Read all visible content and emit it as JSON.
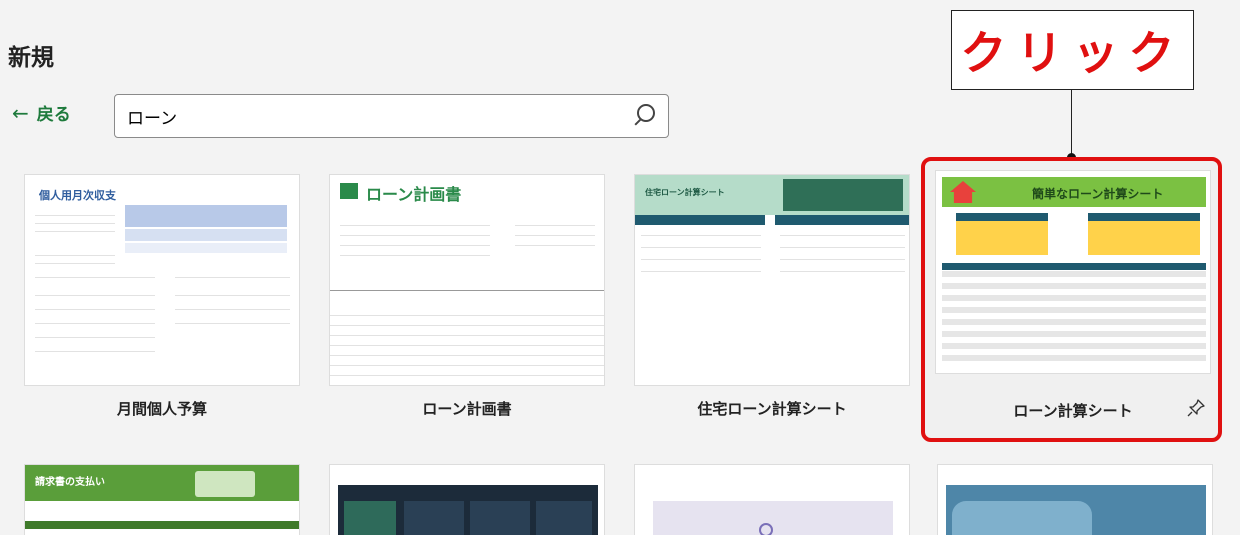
{
  "page": {
    "title": "新規"
  },
  "nav": {
    "back_label": "戻る"
  },
  "search": {
    "value": "ローン",
    "placeholder": ""
  },
  "annotation": {
    "text": "クリック",
    "color": "#e01010"
  },
  "accent_color": "#1e7a3c",
  "templates": [
    {
      "label": "月間個人予算",
      "thumb_title": "個人用月次収支"
    },
    {
      "label": "ローン計画書",
      "thumb_title": "ローン計画書"
    },
    {
      "label": "住宅ローン計算シート",
      "thumb_title": "住宅ローン計算シート"
    },
    {
      "label": "ローン計算シート",
      "thumb_title": "簡単なローン計算シート",
      "selected": true
    }
  ],
  "templates_row2": [
    {
      "thumb_title": "請求書の支払い"
    }
  ],
  "icons": {
    "pin": "pin-icon",
    "search": "search-icon",
    "back": "back-arrow-icon"
  }
}
